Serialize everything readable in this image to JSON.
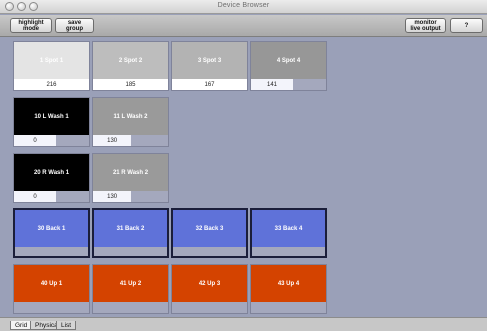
{
  "window": {
    "title": "Device Browser"
  },
  "toolbar": {
    "highlight_mode": "highlight mode",
    "save_group": "save group",
    "monitor_live_output": "monitor live output",
    "help": "?"
  },
  "colors": {
    "background": "#9aa0b8",
    "black": "#000000",
    "blue": "#5f72d9",
    "orange": "#d44300",
    "gray_light": "#e4e4e4",
    "gray_mid": "#b9b9b9",
    "gray_dark": "#999999"
  },
  "devices": [
    {
      "label": "1 Spot 1",
      "value": "216",
      "fill_percent": 100,
      "color": "#e4e4e4"
    },
    {
      "label": "2 Spot 2",
      "value": "185",
      "fill_percent": 100,
      "color": "#bdbdbd"
    },
    {
      "label": "3 Spot 3",
      "value": "167",
      "fill_percent": 100,
      "color": "#b3b3b3"
    },
    {
      "label": "4 Spot 4",
      "value": "141",
      "fill_percent": 56,
      "color": "#979797"
    },
    {
      "label": "10 L Wash 1",
      "value": "0",
      "fill_percent": 0,
      "color": "#000000"
    },
    {
      "label": "11 L Wash 2",
      "value": "130",
      "fill_percent": 51,
      "color": "#9a9a9a"
    },
    {
      "label": "20 R Wash 1",
      "value": "0",
      "fill_percent": 0,
      "color": "#000000"
    },
    {
      "label": "21 R Wash 2",
      "value": "130",
      "fill_percent": 51,
      "color": "#9a9a9a"
    },
    {
      "label": "30 Back 1",
      "value": "",
      "fill_percent": 0,
      "color": "#5f72d9"
    },
    {
      "label": "31 Back 2",
      "value": "",
      "fill_percent": 0,
      "color": "#5f72d9"
    },
    {
      "label": "32 Back 3",
      "value": "",
      "fill_percent": 0,
      "color": "#5f72d9"
    },
    {
      "label": "33 Back 4",
      "value": "",
      "fill_percent": 0,
      "color": "#5f72d9"
    },
    {
      "label": "40 Up 1",
      "value": "",
      "fill_percent": 0,
      "color": "#d44300"
    },
    {
      "label": "41 Up 2",
      "value": "",
      "fill_percent": 0,
      "color": "#d44300"
    },
    {
      "label": "42 Up 3",
      "value": "",
      "fill_percent": 0,
      "color": "#d44300"
    },
    {
      "label": "43 Up 4",
      "value": "",
      "fill_percent": 0,
      "color": "#d44300"
    }
  ],
  "tabs": [
    {
      "label": "Grid",
      "active": true
    },
    {
      "label": "Physical",
      "active": false
    },
    {
      "label": "List",
      "active": false
    }
  ]
}
